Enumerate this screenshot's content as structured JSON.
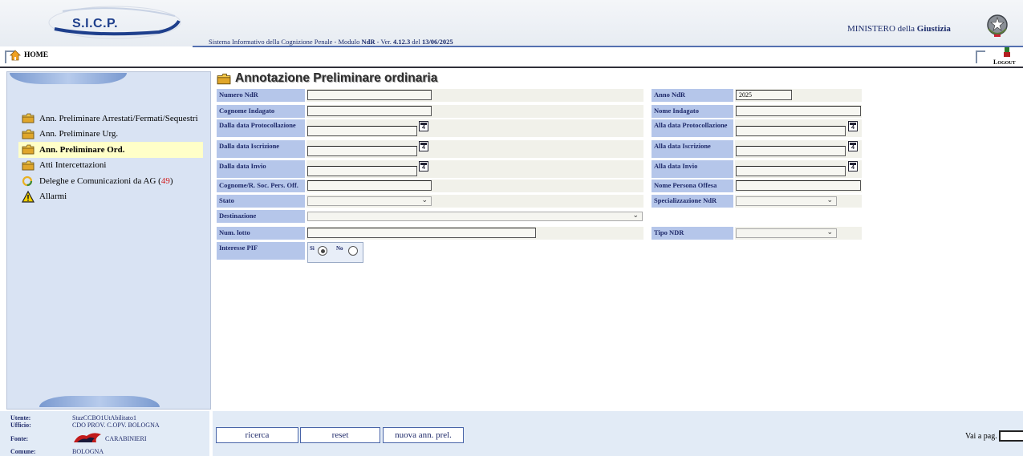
{
  "header": {
    "logo_text": "S.I.C.P.",
    "system_prefix": "Sistema Informativo della Cognizione Penale - Modulo ",
    "module": "NdR",
    "version_prefix": " - Ver. ",
    "version": "4.12.3",
    "date_prefix": " del ",
    "date": "13/06/2025",
    "ministry_prefix": "MINISTERO della ",
    "ministry_bold": "Giustizia"
  },
  "nav": {
    "home_label": "HOME",
    "logout_label": "Logout"
  },
  "sidebar": {
    "items": [
      {
        "label": "Ann. Preliminare Arrestati/Fermati/Sequestri",
        "icon": "folder-icon"
      },
      {
        "label": "Ann. Preliminare Urg.",
        "icon": "folder-icon"
      },
      {
        "label": "Ann. Preliminare Ord.",
        "icon": "folder-icon",
        "active": true
      },
      {
        "label": "Atti Intercettazioni",
        "icon": "folder-icon"
      },
      {
        "label": "Deleghe e Comunicazioni da AG (",
        "count": "49",
        "suffix": ")",
        "icon": "refresh-icon"
      },
      {
        "label": "Allarmi",
        "icon": "warning-icon"
      }
    ]
  },
  "form": {
    "title": "Annotazione Preliminare ordinaria",
    "numero_ndr": {
      "label": "Numero NdR",
      "value": ""
    },
    "anno_ndr": {
      "label": "Anno NdR",
      "value": "2025"
    },
    "cognome_indagato": {
      "label": "Cognome Indagato",
      "value": ""
    },
    "nome_indagato": {
      "label": "Nome Indagato",
      "value": ""
    },
    "dalla_data_protocollazione": {
      "label": "Dalla data Protocollazione",
      "value": ""
    },
    "alla_data_protocollazione": {
      "label": "Alla data Protocollazione",
      "value": ""
    },
    "dalla_data_iscrizione": {
      "label": "Dalla data Iscrizione",
      "value": ""
    },
    "alla_data_iscrizione": {
      "label": "Alla data Iscrizione",
      "value": ""
    },
    "dalla_data_invio": {
      "label": "Dalla data Invio",
      "value": ""
    },
    "alla_data_invio": {
      "label": "Alla data Invio",
      "value": ""
    },
    "cognome_persona_offesa": {
      "label": "Cognome/R. Soc. Pers. Off.",
      "value": ""
    },
    "nome_persona_offesa": {
      "label": "Nome Persona Offesa",
      "value": ""
    },
    "stato": {
      "label": "Stato",
      "value": ""
    },
    "specializzazione": {
      "label": "Specializzazione NdR",
      "value": ""
    },
    "destinazione": {
      "label": "Destinazione",
      "value": ""
    },
    "num_lotto": {
      "label": "Num. lotto",
      "value": ""
    },
    "tipo_ndr": {
      "label": "Tipo NDR",
      "value": ""
    },
    "interesse_pif": {
      "label": "Interesse PIF",
      "yes_label": "Sì",
      "no_label": "No",
      "selected": "Sì"
    }
  },
  "footer": {
    "utente_label": "Utente:",
    "utente": "StazCCBO1UtAbilitato1",
    "ufficio_label": "Ufficio:",
    "ufficio": "CDO PROV. C.OPV. BOLOGNA",
    "fonte_label": "Fonte:",
    "fonte": "CARABINIERI",
    "comune_label": "Comune:",
    "comune": "BOLOGNA",
    "buttons": {
      "ricerca": "ricerca",
      "reset": "reset",
      "nuova": "nuova ann. prel."
    },
    "goto_label": "Vai a pag.",
    "goto_value": ""
  },
  "colors": {
    "label_bg": "#b5c6ea",
    "sidebar_bg": "#d9e3f3",
    "active_item": "#ffffc8",
    "count_red": "#d21c1c",
    "header_blue": "#1e3f8c"
  }
}
